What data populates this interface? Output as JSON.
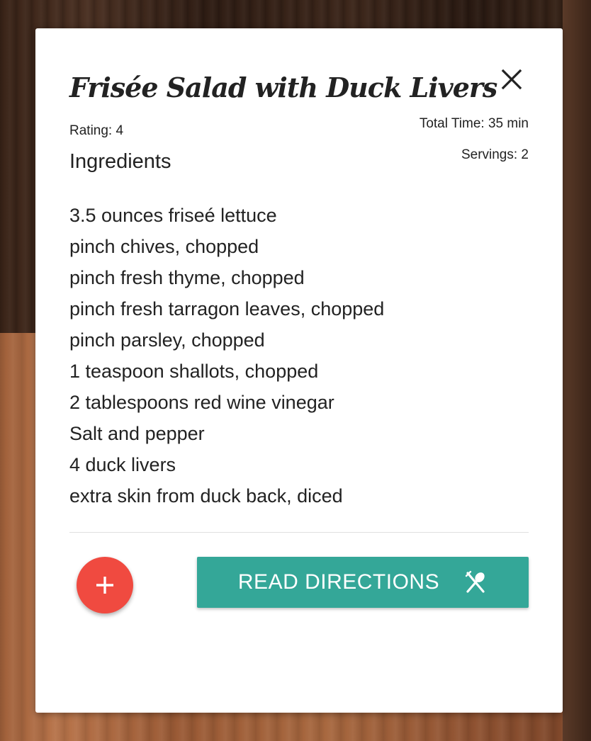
{
  "recipe": {
    "title": "Frisée Salad with Duck Livers",
    "rating": "Rating: 4",
    "total_time": "Total Time: 35 min",
    "servings": "Servings: 2",
    "ingredients_heading": "Ingredients",
    "ingredients": [
      "3.5 ounces friseé lettuce",
      "pinch chives, chopped",
      "pinch fresh thyme, chopped",
      "pinch fresh tarragon leaves, chopped",
      "pinch parsley, chopped",
      "1 teaspoon shallots, chopped",
      "2 tablespoons red wine vinegar",
      "Salt and pepper",
      "4 duck livers",
      "extra skin from duck back, diced"
    ]
  },
  "actions": {
    "close_icon": "close-icon",
    "add_icon": "plus-icon",
    "read_directions_label": "READ DIRECTIONS",
    "read_directions_icon": "utensils-icon"
  },
  "colors": {
    "add_button": "#f04a40",
    "read_button": "#34a798",
    "text": "#222222",
    "card": "#ffffff"
  }
}
